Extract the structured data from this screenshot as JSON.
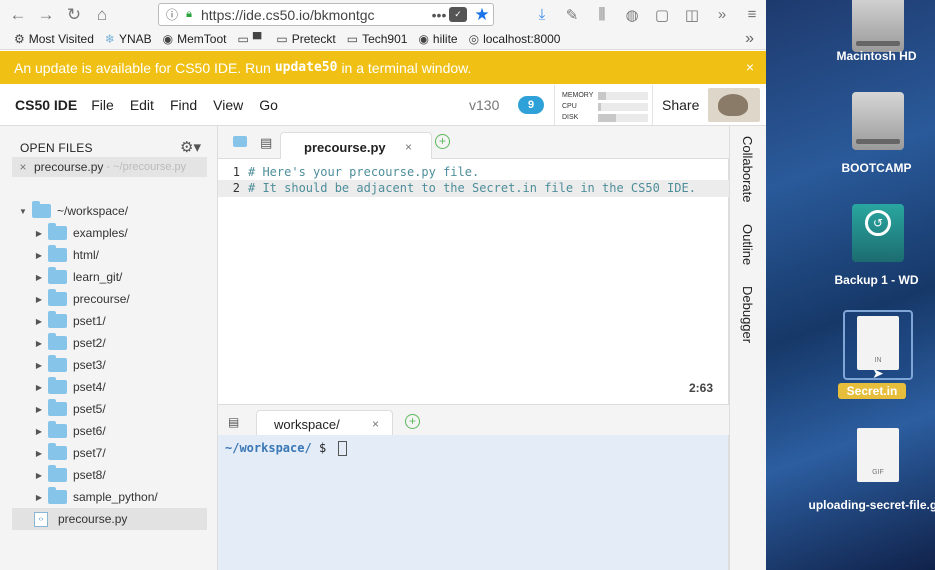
{
  "browser": {
    "url": "https://ide.cs50.io/bkmontgc",
    "bookmarks": [
      "Most Visited",
      "YNAB",
      "MemToot",
      "",
      "Preteckt",
      "Tech901",
      "hilite",
      "localhost:8000"
    ]
  },
  "banner": {
    "text_before": "An update is available for CS50 IDE. Run",
    "command": "update50",
    "text_after": "in a terminal window.",
    "close": "×"
  },
  "menubar": {
    "brand": "CS50 IDE",
    "items": [
      "File",
      "Edit",
      "Find",
      "View",
      "Go"
    ],
    "version": "v130",
    "notifications": "9",
    "stats": {
      "memory_label": "MEMORY",
      "cpu_label": "CPU",
      "disk_label": "DISK",
      "memory_level": 0.15,
      "cpu_level": 0.05,
      "disk_level": 0.35
    },
    "share": "Share"
  },
  "sidebar": {
    "open_files_title": "OPEN FILES",
    "open_file": {
      "close": "×",
      "name": "precourse.py",
      "path": "- ~/precourse.py"
    },
    "tree": [
      {
        "label": "~/workspace/",
        "type": "root"
      },
      {
        "label": "examples/",
        "type": "folder"
      },
      {
        "label": "html/",
        "type": "folder"
      },
      {
        "label": "learn_git/",
        "type": "folder"
      },
      {
        "label": "precourse/",
        "type": "folder"
      },
      {
        "label": "pset1/",
        "type": "folder"
      },
      {
        "label": "pset2/",
        "type": "folder"
      },
      {
        "label": "pset3/",
        "type": "folder"
      },
      {
        "label": "pset4/",
        "type": "folder"
      },
      {
        "label": "pset5/",
        "type": "folder"
      },
      {
        "label": "pset6/",
        "type": "folder"
      },
      {
        "label": "pset7/",
        "type": "folder"
      },
      {
        "label": "pset8/",
        "type": "folder"
      },
      {
        "label": "sample_python/",
        "type": "folder"
      },
      {
        "label": "precourse.py",
        "type": "file"
      }
    ]
  },
  "editor": {
    "tab_title": "precourse.py",
    "tab_close": "×",
    "lines": [
      {
        "num": "1",
        "text": "# Here's your precourse.py file."
      },
      {
        "num": "2",
        "text": "# It should be adjacent to the Secret.in file in the CS50 IDE."
      }
    ],
    "cursor_position": "2:63"
  },
  "terminal": {
    "tab_title": "workspace/",
    "tab_close": "×",
    "prompt_path": "~/workspace/",
    "prompt_symbol": "$"
  },
  "right_panel": [
    "Collaborate",
    "Outline",
    "Debugger"
  ],
  "desktop": {
    "icons": [
      {
        "label": "Macintosh HD"
      },
      {
        "label": "BOOTCAMP"
      },
      {
        "label": "Backup 1 - WD"
      },
      {
        "label": "Secret.in",
        "badge": "IN"
      },
      {
        "label": "uploading-secret-file.gif",
        "badge": "GIF"
      }
    ]
  }
}
